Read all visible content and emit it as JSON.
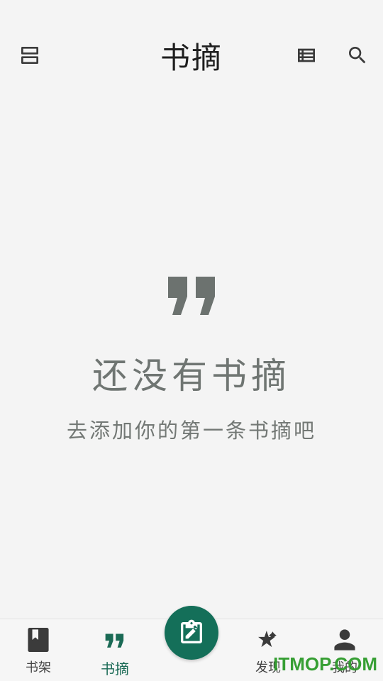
{
  "header": {
    "title": "书摘",
    "left_icon": "view-agenda-icon",
    "right_icons": [
      "list-view-icon",
      "search-icon"
    ]
  },
  "empty_state": {
    "icon": "format-quote-icon",
    "title": "还没有书摘",
    "subtitle": "去添加你的第一条书摘吧"
  },
  "bottom_nav": {
    "items": [
      {
        "label": "书架",
        "icon": "book-icon",
        "active": false
      },
      {
        "label": "书摘",
        "icon": "format-quote-icon",
        "active": true
      },
      {
        "label": "发现",
        "icon": "auto-awesome-icon",
        "active": false
      },
      {
        "label": "我的",
        "icon": "person-icon",
        "active": false
      }
    ],
    "fab_icon": "edit-note-icon"
  },
  "watermark": "ITMOP.COM",
  "colors": {
    "accent": "#146f59",
    "background": "#f4f4f4",
    "muted_text": "#6f7572"
  }
}
